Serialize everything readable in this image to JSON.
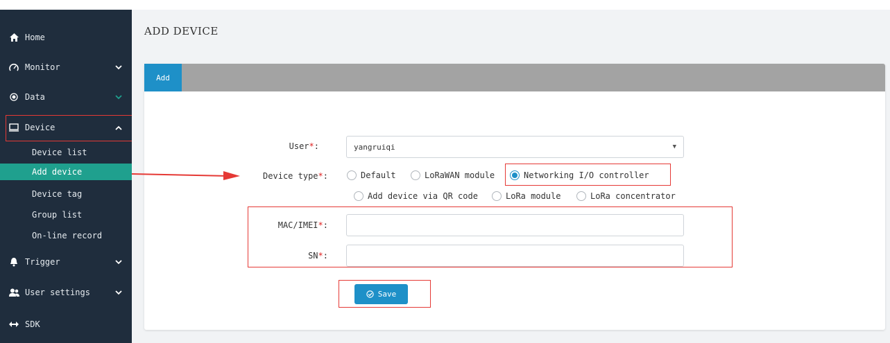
{
  "sidebar": {
    "items": [
      {
        "label": "Home",
        "icon": "home-icon"
      },
      {
        "label": "Monitor",
        "icon": "dashboard-gauge-icon"
      },
      {
        "label": "Data",
        "icon": "radio-target-icon"
      },
      {
        "label": "Device",
        "icon": "monitor-icon"
      },
      {
        "label": "Trigger",
        "icon": "bell-icon"
      },
      {
        "label": "User settings",
        "icon": "users-icon"
      },
      {
        "label": "SDK",
        "icon": "arrows-horizontal-icon"
      }
    ],
    "device_sub": [
      {
        "label": "Device list"
      },
      {
        "label": "Add device"
      },
      {
        "label": "Device tag"
      },
      {
        "label": "Group list"
      },
      {
        "label": "On-line record"
      }
    ]
  },
  "page": {
    "title": "ADD DEVICE"
  },
  "tabs": [
    {
      "label": "Add"
    }
  ],
  "form": {
    "user_label": "User",
    "device_type_label": "Device type",
    "mac_label": "MAC/IMEI",
    "sn_label": "SN",
    "required_mark": "*",
    "colon": ":",
    "user_value": "yangruiqi",
    "device_types": [
      {
        "label": "Default",
        "selected": false
      },
      {
        "label": "LoRaWAN module",
        "selected": false
      },
      {
        "label": "Networking I/O controller",
        "selected": true
      },
      {
        "label": "Add device via QR code",
        "selected": false
      },
      {
        "label": "LoRa module",
        "selected": false
      },
      {
        "label": "LoRa concentrator",
        "selected": false
      }
    ],
    "mac_value": "",
    "sn_value": "",
    "save_label": "Save"
  },
  "colors": {
    "sidebar_bg": "#1f2d3d",
    "active_sub_bg": "#1fa08e",
    "accent": "#1e90c8",
    "annotation_red": "#e53935",
    "tabbar_bg": "#a3a3a3"
  }
}
